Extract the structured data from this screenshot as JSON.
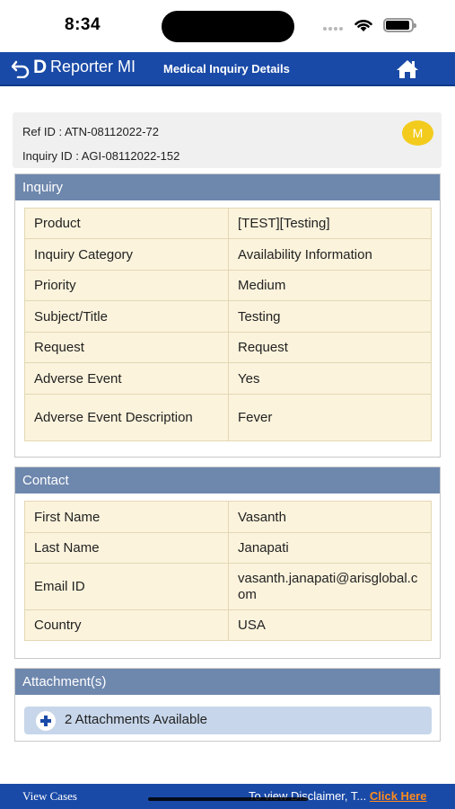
{
  "status_bar": {
    "time": "8:34"
  },
  "header": {
    "app_name": "Reporter MI",
    "logo_letter": "D",
    "page_title": "Medical Inquiry Details"
  },
  "reference": {
    "ref_id": "Ref ID : ATN-08112022-72",
    "inquiry_id": "Inquiry ID : AGI-08112022-152",
    "badge": "M",
    "badge_color": "#f2cb1d"
  },
  "inquiry": {
    "heading": "Inquiry",
    "rows": [
      {
        "label": "Product",
        "value": "[TEST][Testing]"
      },
      {
        "label": "Inquiry Category",
        "value": "Availability Information"
      },
      {
        "label": "Priority",
        "value": "Medium"
      },
      {
        "label": "Subject/Title",
        "value": "Testing"
      },
      {
        "label": "Request",
        "value": "Request"
      },
      {
        "label": "Adverse Event",
        "value": "Yes"
      },
      {
        "label": "Adverse Event Description",
        "value": "Fever"
      }
    ]
  },
  "contact": {
    "heading": "Contact",
    "rows": [
      {
        "label": "First Name",
        "value": "Vasanth"
      },
      {
        "label": "Last Name",
        "value": "Janapati"
      },
      {
        "label": "Email ID",
        "value": "vasanth.janapati@arisglobal.com"
      },
      {
        "label": "Country",
        "value": "USA"
      }
    ]
  },
  "attachments": {
    "heading": "Attachment(s)",
    "button_label": "2 Attachments Available"
  },
  "footer": {
    "view_cases": "View Cases",
    "disclaimer": "To view Disclaimer, T...",
    "link": "Click Here"
  },
  "colors": {
    "header_blue": "#1a4aa7",
    "section_head": "#6e87ad",
    "cell_bg": "#fbf3dc",
    "link_orange": "#ff8a1c"
  }
}
